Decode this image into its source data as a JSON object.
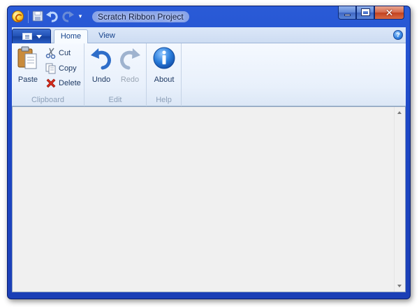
{
  "window": {
    "title": "Scratch Ribbon Project",
    "qat": {
      "customize_glyph": "▾",
      "icons": [
        "save-icon",
        "undo-icon",
        "redo-icon"
      ]
    },
    "caption": {
      "close_glyph": "✕"
    }
  },
  "ribbon": {
    "tabs": [
      {
        "label": "Home",
        "selected": true
      },
      {
        "label": "View",
        "selected": false
      }
    ],
    "help_glyph": "?",
    "groups": [
      {
        "label": "Clipboard",
        "buttons": [
          {
            "label": "Paste",
            "icon": "paste-icon",
            "size": "large",
            "enabled": true
          },
          {
            "label": "Cut",
            "icon": "scissors-icon",
            "size": "small",
            "enabled": true
          },
          {
            "label": "Copy",
            "icon": "copy-icon",
            "size": "small",
            "enabled": true
          },
          {
            "label": "Delete",
            "icon": "delete-icon",
            "size": "small",
            "enabled": true
          }
        ]
      },
      {
        "label": "Edit",
        "buttons": [
          {
            "label": "Undo",
            "icon": "undo-icon",
            "size": "large",
            "enabled": true
          },
          {
            "label": "Redo",
            "icon": "redo-icon",
            "size": "large",
            "enabled": false
          }
        ]
      },
      {
        "label": "Help",
        "buttons": [
          {
            "label": "About",
            "icon": "info-icon",
            "size": "large",
            "enabled": true
          }
        ]
      }
    ]
  },
  "colors": {
    "frame": "#1d47c6",
    "ribbon_background": "#e8f0fb",
    "content_background": "#f0f0f0",
    "group_label": "#8da0b8"
  }
}
